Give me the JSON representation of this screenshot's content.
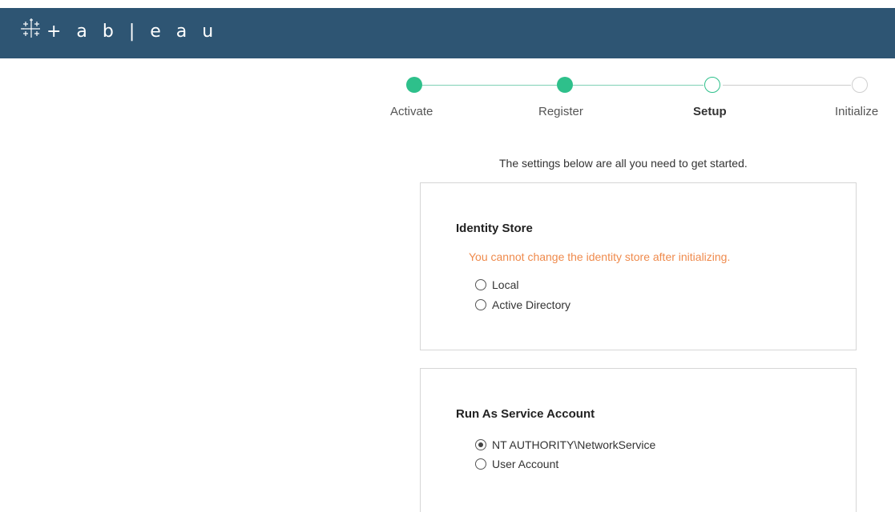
{
  "header": {
    "logo_text": "+ a b | e a u",
    "logo_icon": "tableau-cross-icon",
    "color": "#2e5573"
  },
  "stepper": {
    "accent_color": "#2ec08b",
    "steps": [
      {
        "label": "Activate",
        "state": "done"
      },
      {
        "label": "Register",
        "state": "done"
      },
      {
        "label": "Setup",
        "state": "current"
      },
      {
        "label": "Initialize",
        "state": "future"
      }
    ]
  },
  "intro_text": "The settings below are all you need to get started.",
  "identity_store": {
    "title": "Identity Store",
    "warning": "You cannot change the identity store after initializing.",
    "warning_color": "#ef8a4c",
    "options": [
      {
        "label": "Local",
        "checked": false
      },
      {
        "label": "Active Directory",
        "checked": false
      }
    ]
  },
  "service_account": {
    "title": "Run As Service Account",
    "options": [
      {
        "label": "NT AUTHORITY\\NetworkService",
        "checked": true
      },
      {
        "label": "User Account",
        "checked": false
      }
    ]
  }
}
